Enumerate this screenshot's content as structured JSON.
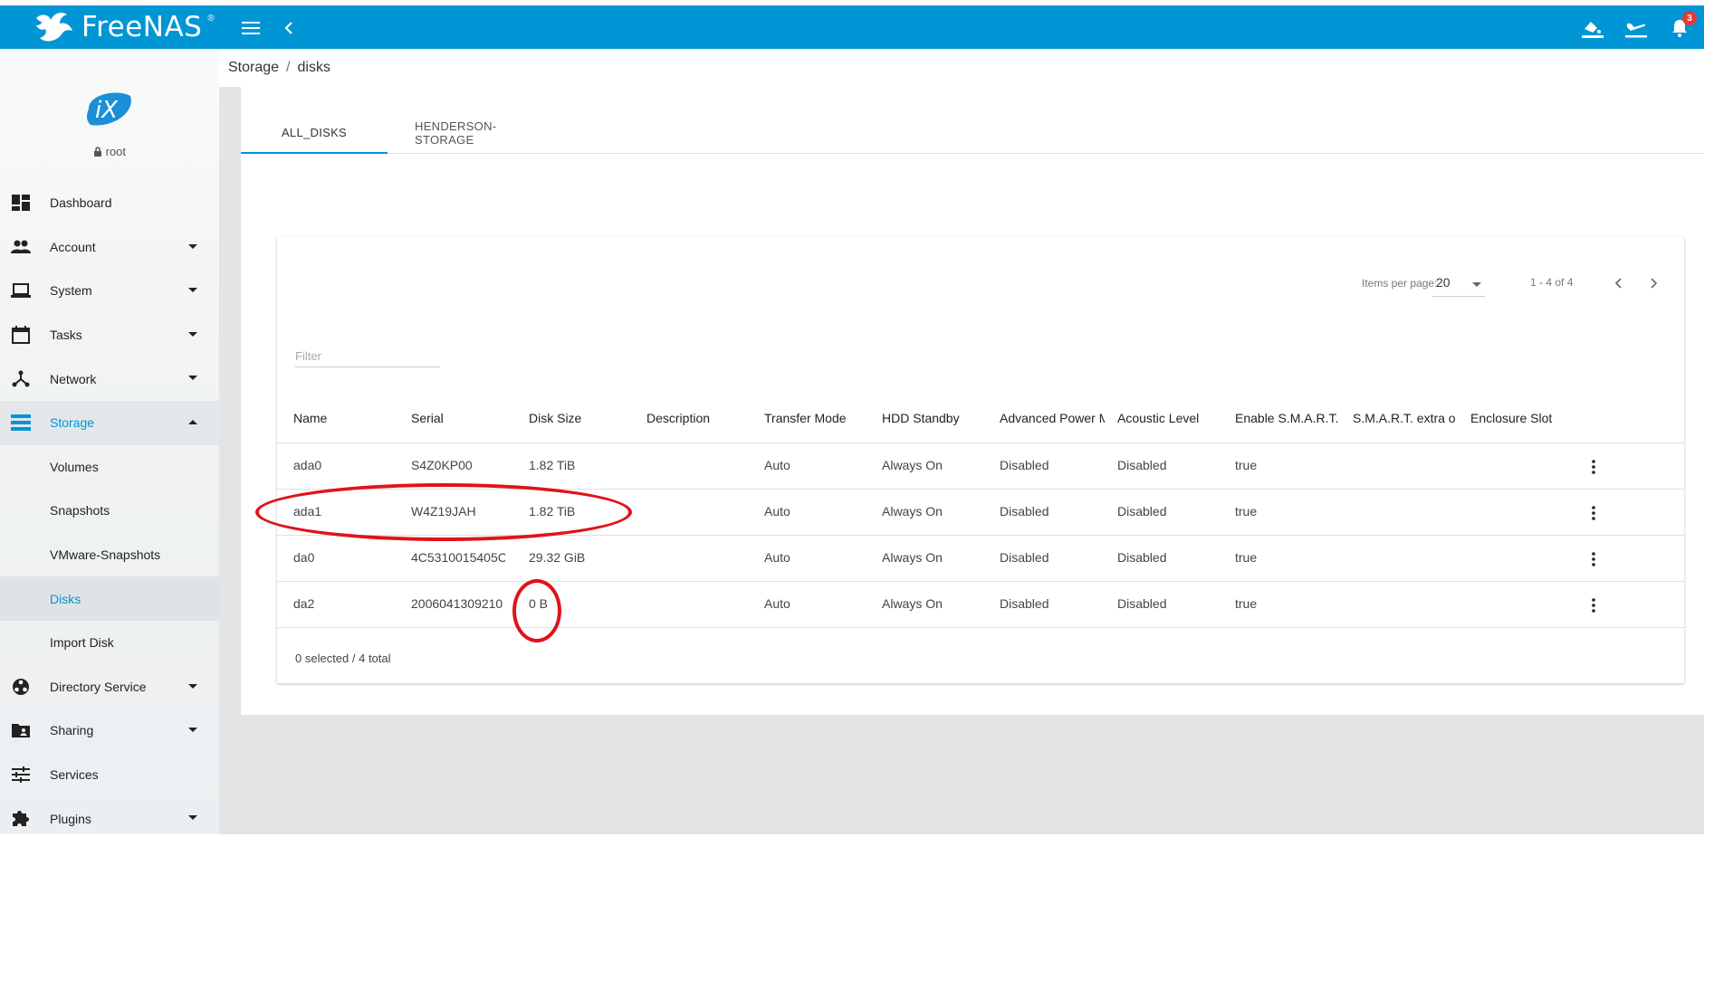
{
  "topbar": {
    "brand": "FreeNAS",
    "brand_mark": "®",
    "notification_count": "3",
    "icons": [
      "menu-icon",
      "back-chevron-icon",
      "wallpaper-icon",
      "airplane-icon",
      "bell-icon"
    ]
  },
  "sidebar": {
    "brand_logo_text": "iX",
    "user": "root",
    "items": [
      {
        "label": "Dashboard",
        "icon": "dashboard-icon"
      },
      {
        "label": "Account",
        "icon": "people-icon"
      },
      {
        "label": "System",
        "icon": "laptop-icon"
      },
      {
        "label": "Tasks",
        "icon": "calendar-icon"
      },
      {
        "label": "Network",
        "icon": "network-icon"
      },
      {
        "label": "Storage",
        "icon": "storage-icon"
      },
      {
        "label": "Directory Service",
        "icon": "directory-icon"
      },
      {
        "label": "Sharing",
        "icon": "folder-shared-icon"
      },
      {
        "label": "Services",
        "icon": "tune-icon"
      },
      {
        "label": "Plugins",
        "icon": "extension-icon"
      }
    ],
    "storage_sub": [
      "Volumes",
      "Snapshots",
      "VMware-Snapshots",
      "Disks",
      "Import Disk"
    ],
    "accent": "#0095d5"
  },
  "breadcrumb": {
    "root": "Storage",
    "separator": "/",
    "current": "disks"
  },
  "tabs": [
    "ALL_DISKS",
    "HENDERSON-STORAGE"
  ],
  "paginator": {
    "label": "Items per page:",
    "page_size": "20",
    "range": "1 - 4 of 4"
  },
  "filter": {
    "placeholder": "Filter",
    "value": ""
  },
  "table": {
    "columns": [
      "Name",
      "Serial",
      "Disk Size",
      "Description",
      "Transfer Mode",
      "HDD Standby",
      "Advanced Power Management",
      "Acoustic Level",
      "Enable S.M.A.R.T.",
      "S.M.A.R.T. extra options",
      "Enclosure Slot"
    ],
    "rows": [
      {
        "name": "ada0",
        "serial": "S4Z0KP00",
        "size": "1.82 TiB",
        "description": "",
        "transfer": "Auto",
        "standby": "Always On",
        "apm": "Disabled",
        "acoustic": "Disabled",
        "smart": "true",
        "smart_opts": "",
        "slot": ""
      },
      {
        "name": "ada1",
        "serial": "W4Z19JAH",
        "size": "1.82 TiB",
        "description": "",
        "transfer": "Auto",
        "standby": "Always On",
        "apm": "Disabled",
        "acoustic": "Disabled",
        "smart": "true",
        "smart_opts": "",
        "slot": ""
      },
      {
        "name": "da0",
        "serial": "4C5310015405C",
        "size": "29.32 GiB",
        "description": "",
        "transfer": "Auto",
        "standby": "Always On",
        "apm": "Disabled",
        "acoustic": "Disabled",
        "smart": "true",
        "smart_opts": "",
        "slot": ""
      },
      {
        "name": "da2",
        "serial": "2006041309210",
        "size": "0 B",
        "description": "",
        "transfer": "Auto",
        "standby": "Always On",
        "apm": "Disabled",
        "acoustic": "Disabled",
        "smart": "true",
        "smart_opts": "",
        "slot": ""
      }
    ],
    "footer": "0 selected / 4 total"
  },
  "annotation_color": "#e0131a"
}
